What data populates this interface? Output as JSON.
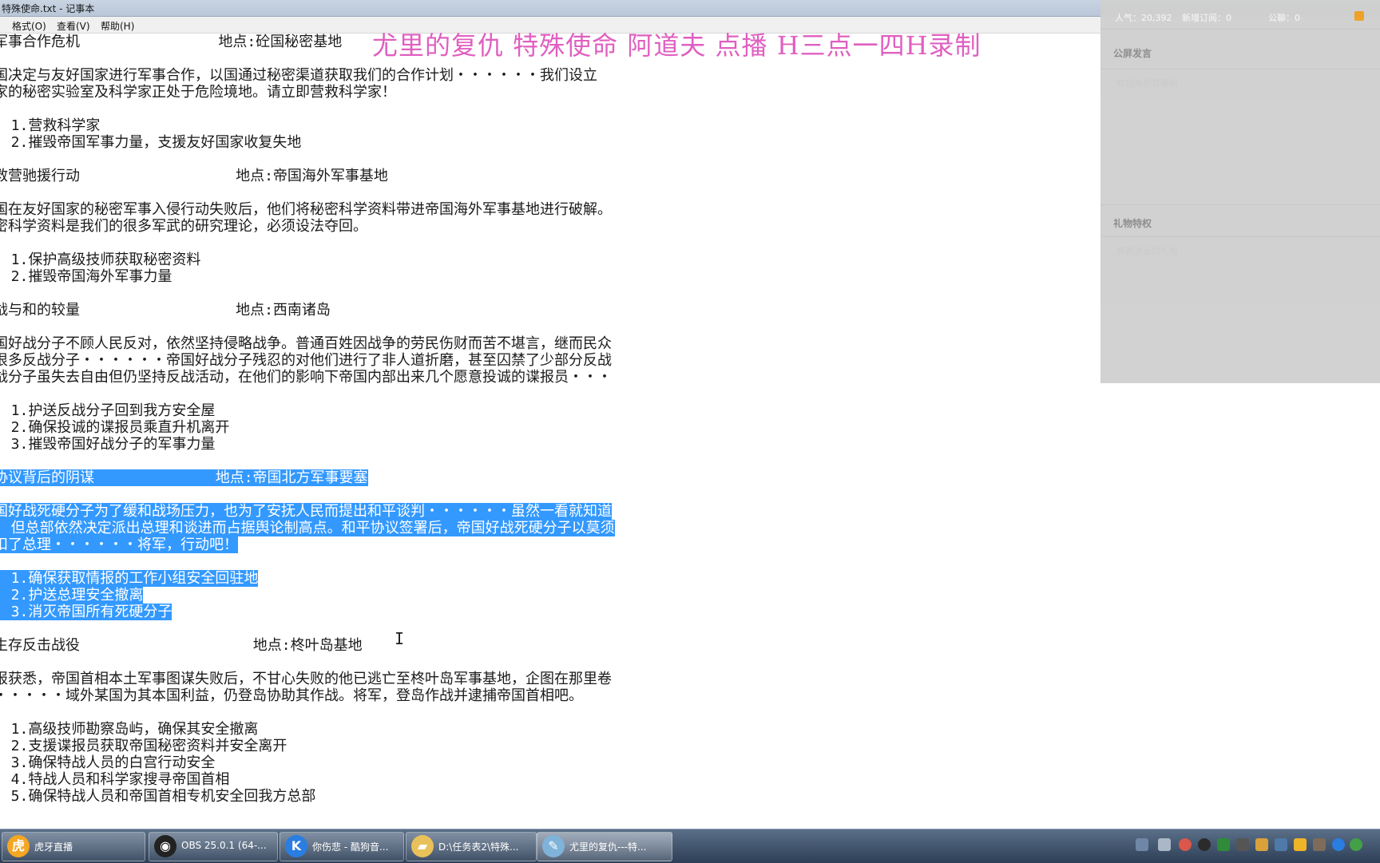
{
  "window": {
    "title": "特殊使命.txt - 记事本"
  },
  "menu": [
    "格式(O)",
    "查看(V)",
    "帮助(H)"
  ],
  "overlay_text": "尤里的复仇 特殊使命 阿道夫 点播 H三点一四H录制",
  "panel": {
    "stats_left": "人气：20,392",
    "stats_mid": "新增订阅：0",
    "stats_right": "公聊：0",
    "section_public": "公屏发言",
    "public_placeholder": "欢迎来到直播间",
    "section_gift": "礼物特权",
    "gift_placeholder": "感谢送出的礼物"
  },
  "lines": [
    {
      "text": "军事合作危机                地点:砼国秘密基地",
      "sel": false
    },
    {
      "text": "",
      "sel": false
    },
    {
      "text": "国决定与友好国家进行军事合作，以国通过秘密渠道获取我们的合作计划・・・・・・我们设立",
      "sel": false
    },
    {
      "text": "家的秘密实验室及科学家正处于危险境地。请立即营救科学家！",
      "sel": false
    },
    {
      "text": "",
      "sel": false
    },
    {
      "text": "  1.营救科学家",
      "sel": false
    },
    {
      "text": "  2.摧毁帝国军事力量，支援友好国家收复失地",
      "sel": false
    },
    {
      "text": "",
      "sel": false
    },
    {
      "text": "救营驰援行动                  地点:帝国海外军事基地",
      "sel": false
    },
    {
      "text": "",
      "sel": false
    },
    {
      "text": "国在友好国家的秘密军事入侵行动失败后，他们将秘密科学资料带进帝国海外军事基地进行破解。",
      "sel": false
    },
    {
      "text": "密科学资料是我们的很多军武的研究理论，必须设法夺回。",
      "sel": false
    },
    {
      "text": "",
      "sel": false
    },
    {
      "text": "  1.保护高级技师获取秘密资料",
      "sel": false
    },
    {
      "text": "  2.摧毁帝国海外军事力量",
      "sel": false
    },
    {
      "text": "",
      "sel": false
    },
    {
      "text": "战与和的较量                  地点:西南诸岛",
      "sel": false
    },
    {
      "text": "",
      "sel": false
    },
    {
      "text": "国好战分子不顾人民反对，依然坚持侵略战争。普通百姓因战争的劳民伤财而苦不堪言，继而民众",
      "sel": false
    },
    {
      "text": "很多反战分子・・・・・・帝国好战分子残忍的对他们进行了非人道折磨，甚至囚禁了少部分反战",
      "sel": false
    },
    {
      "text": "战分子虽失去自由但仍坚持反战活动，在他们的影响下帝国内部出来几个愿意投诚的谍报员・・・",
      "sel": false
    },
    {
      "text": "",
      "sel": false
    },
    {
      "text": "  1.护送反战分子回到我方安全屋",
      "sel": false
    },
    {
      "text": "  2.确保投诚的谍报员乘直升机离开",
      "sel": false
    },
    {
      "text": "  3.摧毁帝国好战分子的军事力量",
      "sel": false
    },
    {
      "text": "",
      "sel": false
    },
    {
      "text": "协议背后的阴谋              地点:帝国北方军事要塞",
      "sel": true
    },
    {
      "text": "",
      "sel": false
    },
    {
      "text": "国好战死硬分子为了缓和战场压力，也为了安抚人民而提出和平谈判・・・・・・虽然一看就知道",
      "sel": true
    },
    {
      "text": "  但总部依然决定派出总理和谈进而占据舆论制高点。和平协议签署后，帝国好战死硬分子以莫须",
      "sel": true
    },
    {
      "text": "扣了总理・・・・・・将军，行动吧！",
      "sel": true
    },
    {
      "text": "",
      "sel": false
    },
    {
      "text": "  1.确保获取情报的工作小组安全回驻地",
      "sel": true
    },
    {
      "text": "  2.护送总理安全撤离",
      "sel": true
    },
    {
      "text": "  3.消灭帝国所有死硬分子",
      "sel": true
    },
    {
      "text": "",
      "sel": false
    },
    {
      "text": "生存反击战役                    地点:柊叶岛基地",
      "sel": false
    },
    {
      "text": "",
      "sel": false
    },
    {
      "text": "报获悉，帝国首相本土军事图谋失败后，不甘心失败的他已逃亡至柊叶岛军事基地，企图在那里卷",
      "sel": false
    },
    {
      "text": "・・・・・域外某国为其本国利益，仍登岛协助其作战。将军，登岛作战并逮捕帝国首相吧。",
      "sel": false
    },
    {
      "text": "",
      "sel": false
    },
    {
      "text": "  1.高级技师勘察岛屿，确保其安全撤离",
      "sel": false
    },
    {
      "text": "  2.支援谍报员获取帝国秘密资料并安全离开",
      "sel": false
    },
    {
      "text": "  3.确保特战人员的白宫行动安全",
      "sel": false
    },
    {
      "text": "  4.特战人员和科学家搜寻帝国首相",
      "sel": false
    },
    {
      "text": "  5.确保特战人员和帝国首相专机安全回我方总部",
      "sel": false
    }
  ],
  "taskbar": [
    {
      "label": "虎牙直播",
      "icon": "huya-app-icon",
      "glyph": "虎",
      "color": "#f5a623"
    },
    {
      "label": "OBS 25.0.1 (64-...",
      "icon": "obs-app-icon",
      "glyph": "◉",
      "color": "#222222"
    },
    {
      "label": "你伤悲 - 酷狗音...",
      "icon": "kugou-app-icon",
      "glyph": "K",
      "color": "#2a7de1"
    },
    {
      "label": "D:\\任务表2\\特殊...",
      "icon": "folder-icon",
      "glyph": "▰",
      "color": "#e8c15a"
    },
    {
      "label": "尤里的复仇---特...",
      "icon": "notepad-icon",
      "glyph": "✎",
      "color": "#7fb3d9"
    }
  ]
}
